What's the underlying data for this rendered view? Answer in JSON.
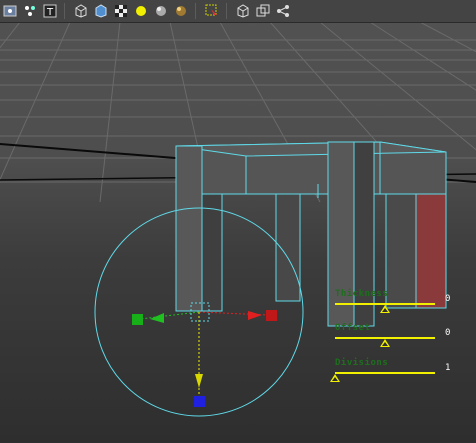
{
  "toolbar": {
    "icons": [
      "selection-mask-icon",
      "component-mode-icon",
      "text-icon",
      "wireframe-icon",
      "smooth-shade-icon",
      "textured-icon",
      "use-all-lights-icon",
      "shadows-icon",
      "ambient-occlusion-icon",
      "select-tool-icon",
      "isolate-select-icon",
      "xray-icon",
      "show-graph-icon"
    ]
  },
  "tool_sliders": [
    {
      "label": "Thickness",
      "value": "0",
      "level": 0.5
    },
    {
      "label": "Offset",
      "value": "0",
      "level": 0.5
    },
    {
      "label": "Divisions",
      "value": "1",
      "level": 0.0
    }
  ],
  "colors": {
    "selection_wire": "#5fd9e8",
    "slider": "#f0f000",
    "manipulator_x": "#e02020",
    "manipulator_y": "#20c020",
    "manipulator_z": "#2020e0",
    "highlighted_face": "#8a3a3a"
  }
}
